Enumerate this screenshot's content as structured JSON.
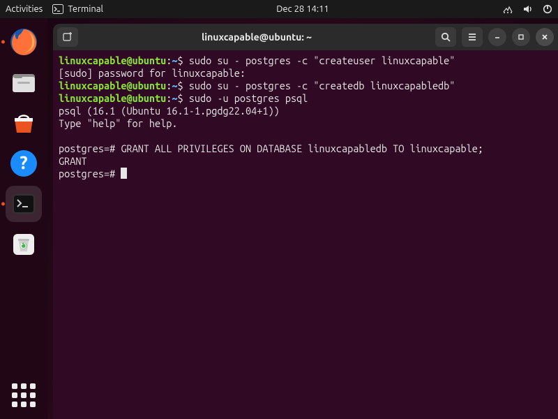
{
  "top_panel": {
    "activities": "Activities",
    "app_name": "Terminal",
    "clock": "Dec 28  14:11"
  },
  "titlebar": {
    "title": "linuxcapable@ubuntu: ~"
  },
  "prompt": {
    "userhost": "linuxcapable@ubuntu",
    "path": "~"
  },
  "terminal": {
    "cmd1": "sudo su - postgres -c \"createuser linuxcapable\"",
    "sudo_line": "[sudo] password for linuxcapable:",
    "cmd2": "sudo su - postgres -c \"createdb linuxcapabledb\"",
    "cmd3": "sudo -u postgres psql",
    "psql_banner1": "psql (16.1 (Ubuntu 16.1-1.pgdg22.04+1))",
    "psql_banner2": "Type \"help\" for help.",
    "psql_prompt": "postgres=#",
    "grant_cmd": "GRANT ALL PRIVILEGES ON DATABASE linuxcapabledb TO linuxcapable;",
    "grant_out": "GRANT"
  }
}
